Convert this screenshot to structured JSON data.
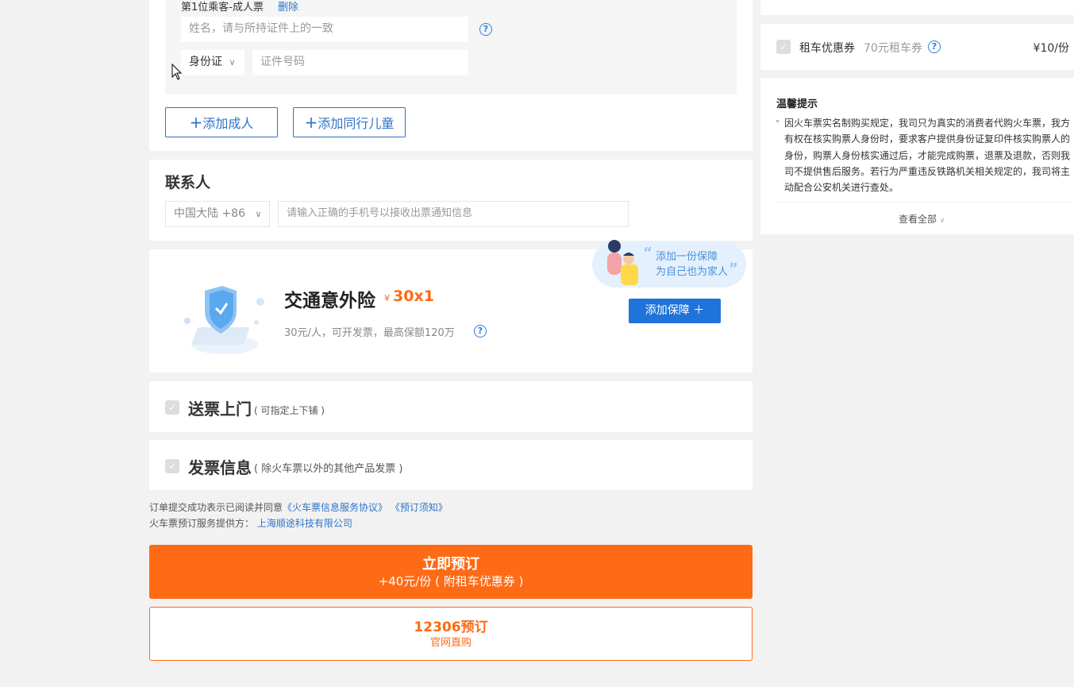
{
  "passenger": {
    "title": "第1位乘客-成人票",
    "delete_label": "删除",
    "name_placeholder": "姓名，请与所持证件上的一致",
    "id_type": "身份证",
    "id_placeholder": "证件号码",
    "add_adult": "添加成人",
    "add_child": "添加同行儿童"
  },
  "contact": {
    "title": "联系人",
    "region": "中国大陆 +86",
    "phone_placeholder": "请输入正确的手机号以接收出票通知信息"
  },
  "insurance": {
    "title": "交通意外险",
    "currency": "¥",
    "price": "30x1",
    "desc": "30元/人，可开发票，最高保额120万",
    "bubble_line1": "添加一份保障",
    "bubble_line2": "为自己也为家人",
    "add_button": "添加保障 ＋"
  },
  "delivery": {
    "title": "送票上门",
    "note": "( 可指定上下铺 )"
  },
  "invoice": {
    "title": "发票信息",
    "note": "( 除火车票以外的其他产品发票 )"
  },
  "agreement": {
    "prefix": "订单提交成功表示已阅读并同意",
    "link1": "《火车票信息服务协议》",
    "link2": "《预订须知》",
    "provider_prefix": "火车票预订服务提供方：",
    "provider": "上海顺途科技有限公司"
  },
  "book_now": {
    "title": "立即预订",
    "subtitle": "+40元/份 ( 附租车优惠券 )"
  },
  "book_12306": {
    "title": "12306预订",
    "subtitle": "官网直购"
  },
  "sidebar": {
    "coupon_label": "租车优惠券",
    "coupon_desc": "70元租车券",
    "coupon_price": "¥10/份",
    "tips_title": "温馨提示",
    "tips_text": "因火车票实名制购买规定，我司只为真实的消费者代购火车票，我方有权在核实购票人身份时，要求客户提供身份证复印件核实购票人的身份，购票人身份核实通过后，才能完成购票，退票及退款，否则我司不提供售后服务。若行为严重违反铁路机关相关规定的，我司将主动配合公安机关进行查处。",
    "view_all": "查看全部"
  },
  "colors": {
    "accent_blue": "#2f73c6",
    "orange": "#ff6a14"
  }
}
